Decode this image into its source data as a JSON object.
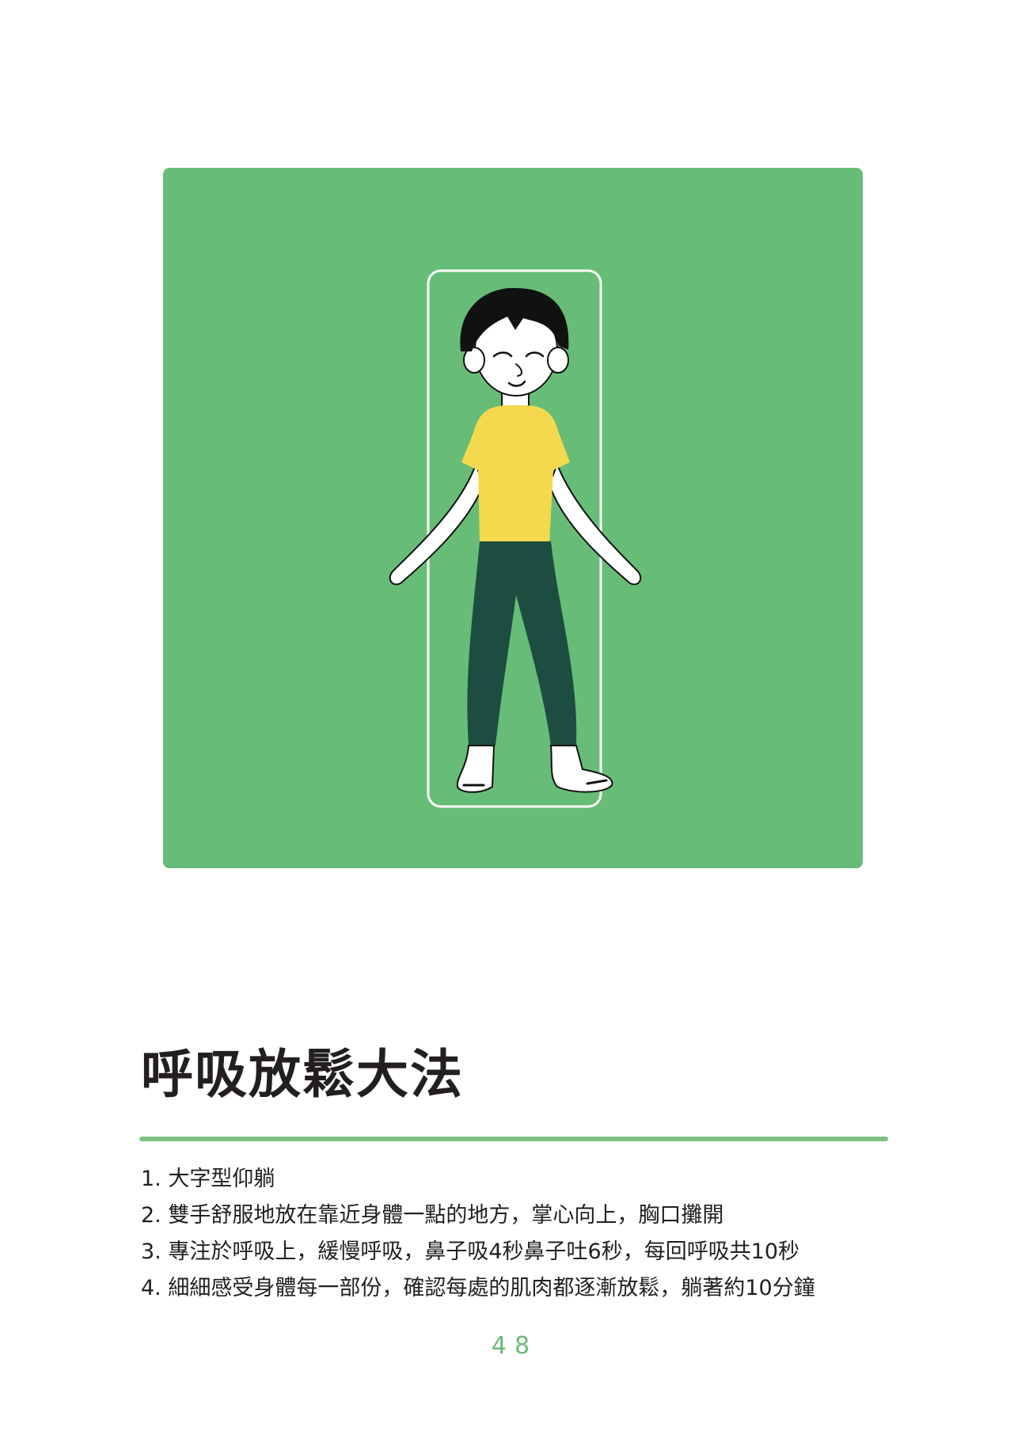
{
  "colors": {
    "panel_green": "#67bd77",
    "shirt_yellow": "#f4d94f",
    "pants_dark_green": "#1d4d40",
    "hair_black": "#111111",
    "skin_white": "#ffffff",
    "rule_green": "#7cc384",
    "page_number_green": "#6cbb77"
  },
  "illustration": {
    "icon": "person-lying-relaxed-illustration"
  },
  "article": {
    "title": "呼吸放鬆大法",
    "steps": [
      "1. 大字型仰躺",
      "2. 雙手舒服地放在靠近身體一點的地方，掌心向上，胸口攤開",
      "3. 專注於呼吸上，緩慢呼吸，鼻子吸4秒鼻子吐6秒，每回呼吸共10秒",
      "4. 細細感受身體每一部份，確認每處的肌肉都逐漸放鬆，躺著約10分鐘"
    ]
  },
  "footer": {
    "page_number": "48"
  }
}
